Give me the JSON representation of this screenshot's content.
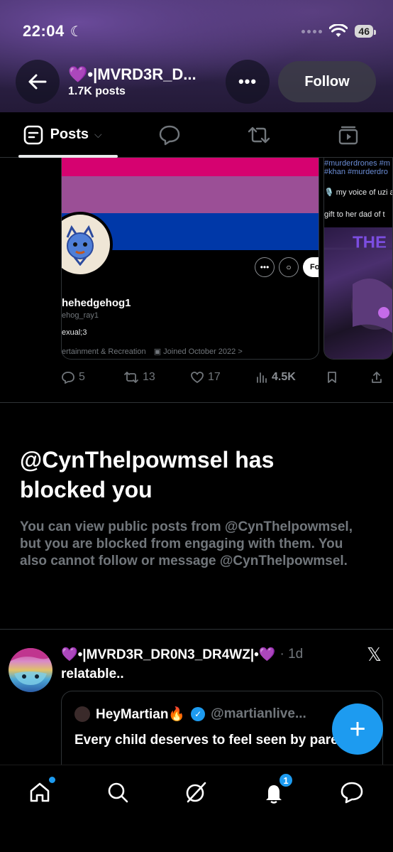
{
  "status_bar": {
    "time": "22:04",
    "battery": "46"
  },
  "header": {
    "profile_name": "💜•|MVRD3R_D...",
    "post_count": "1.7K posts",
    "follow_label": "Follow"
  },
  "tabs": [
    {
      "label": "Posts",
      "icon": "posts-icon"
    },
    {
      "label": "",
      "icon": "replies-icon"
    },
    {
      "label": "",
      "icon": "reposts-icon"
    },
    {
      "label": "",
      "icon": "media-icon"
    }
  ],
  "embedded_card": {
    "name": "hehedgehog1",
    "handle": "ehog_ray1",
    "bio": "exual;3",
    "category": "ertainment & Recreation",
    "joined": "Joined October 2022 >",
    "follow_stub": "Fo"
  },
  "embedded_right": {
    "tags1": "#murderdrones #m",
    "tags2": "#khan #murderdro",
    "line1": "🎙️ my voice of uzi a",
    "line2": "gift to her dad of t",
    "art_text": "THE"
  },
  "post_stats": {
    "replies": "5",
    "reposts": "13",
    "likes": "17",
    "views": "4.5K"
  },
  "blocked": {
    "title": "@CynThelpowmsel has blocked you",
    "body": "You can view public posts from @CynThelpowmsel, but you are blocked from engaging with them. You also cannot follow or message @CynThelpowmsel."
  },
  "tweet": {
    "author": "💜•|MVRD3R_DR0N3_DR4WZ|•💜",
    "time": "· 1d",
    "text": "relatable..",
    "quote": {
      "name": "HeyMartian🔥",
      "handle": "@martianlive...",
      "text": "Every child deserves to feel seen by parents"
    }
  },
  "bottom_nav": {
    "notifications_badge": "1"
  },
  "colors": {
    "accent": "#1d9bf0",
    "muted": "#71767b",
    "background": "#000000"
  }
}
